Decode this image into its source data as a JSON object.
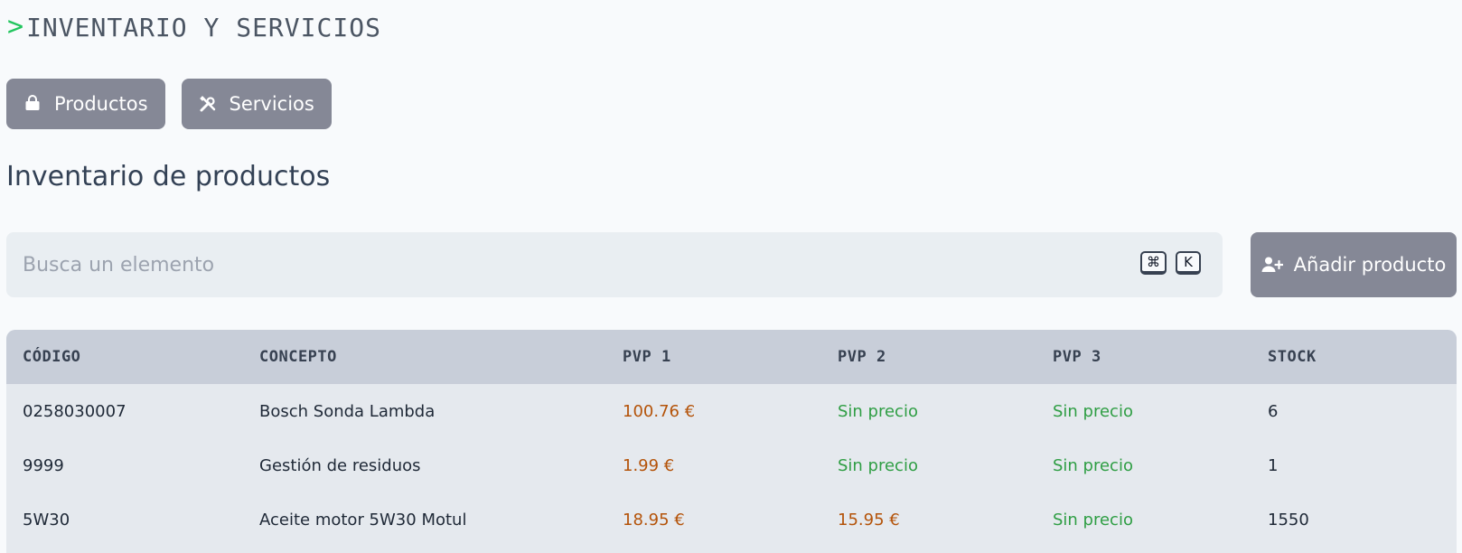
{
  "header": {
    "prompt_symbol": ">",
    "title": "INVENTARIO Y SERVICIOS"
  },
  "tabs": [
    {
      "label": "Productos",
      "icon": "shopping-bag-icon"
    },
    {
      "label": "Servicios",
      "icon": "tools-icon"
    }
  ],
  "section": {
    "title": "Inventario de productos"
  },
  "search": {
    "placeholder": "Busca un elemento",
    "value": "",
    "shortcut_keys": [
      "⌘",
      "K"
    ]
  },
  "add_button": {
    "label": "Añadir producto",
    "icon": "user-plus-icon"
  },
  "table": {
    "headers": [
      "CÓDIGO",
      "CONCEPTO",
      "PVP 1",
      "PVP 2",
      "PVP 3",
      "STOCK"
    ],
    "rows": [
      {
        "codigo": "0258030007",
        "concepto": "Bosch Sonda Lambda",
        "pvp1": "100.76 €",
        "pvp2": "Sin precio",
        "pvp3": "Sin precio",
        "stock": "6"
      },
      {
        "codigo": "9999",
        "concepto": "Gestión de residuos",
        "pvp1": "1.99 €",
        "pvp2": "Sin precio",
        "pvp3": "Sin precio",
        "stock": "1"
      },
      {
        "codigo": "5W30",
        "concepto": "Aceite motor 5W30 Motul",
        "pvp1": "18.95 €",
        "pvp2": "15.95 €",
        "pvp3": "Sin precio",
        "stock": "1550"
      }
    ]
  },
  "colors": {
    "accent_button": "#858896",
    "price_set": "#b45309",
    "price_missing": "#2f9e44",
    "prompt": "#22c55e"
  }
}
